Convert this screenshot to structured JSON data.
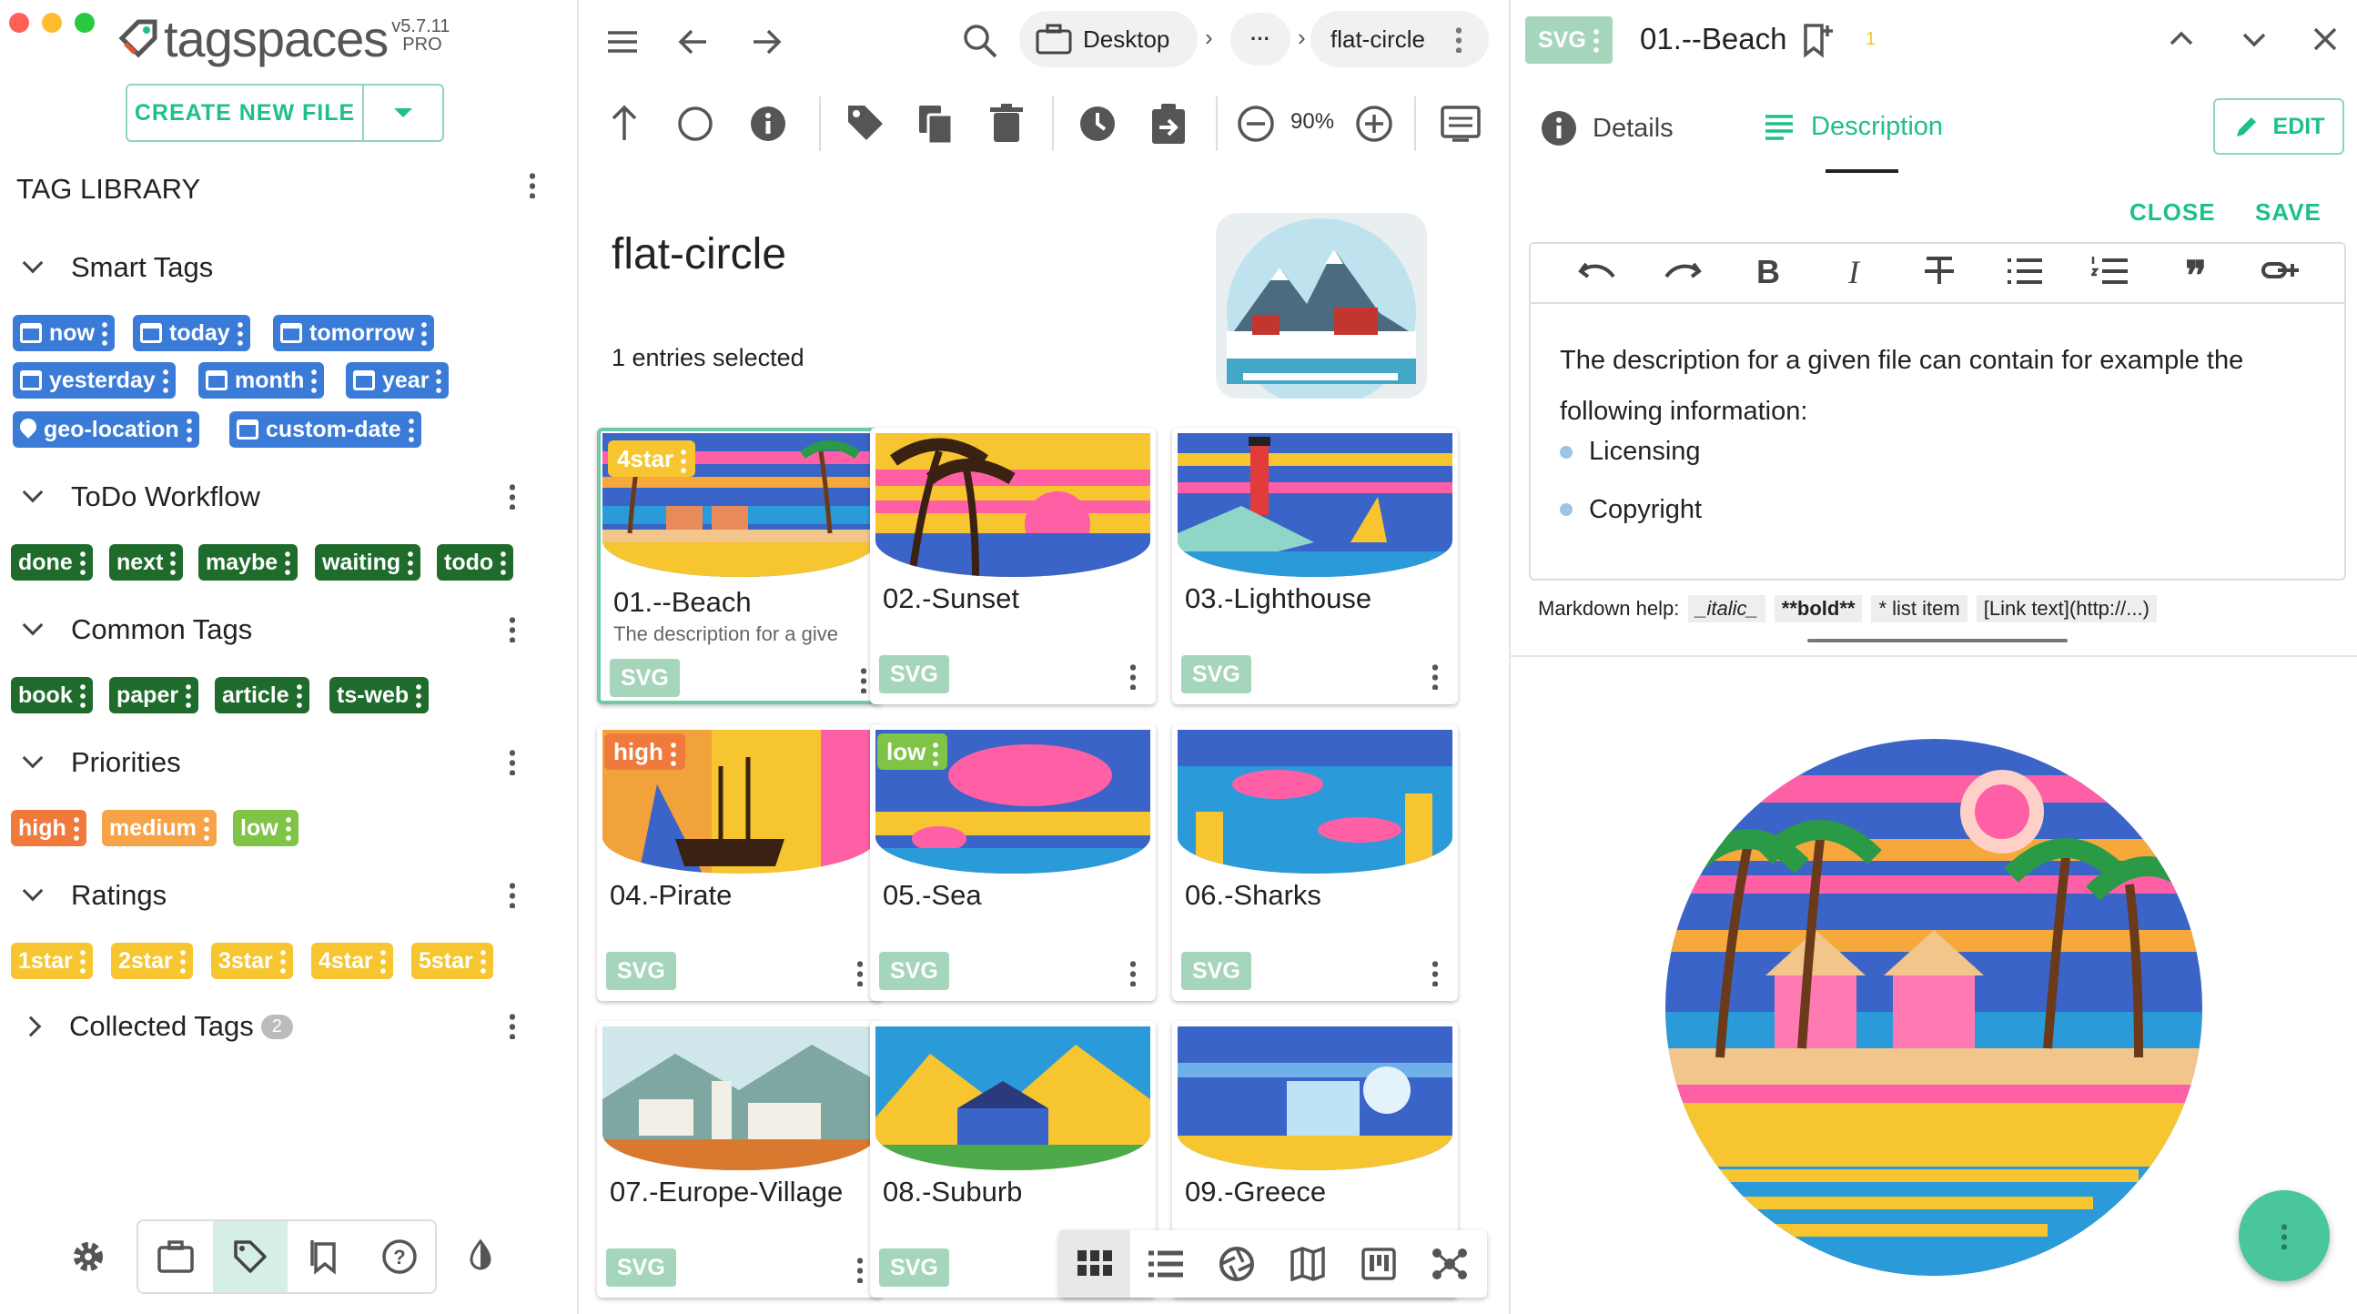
{
  "app": {
    "brand": "tagspaces",
    "version": "v5.7.11",
    "edition": "PRO",
    "create_button": "CREATE NEW FILE"
  },
  "sidebar": {
    "title": "TAG LIBRARY",
    "groups": [
      {
        "name": "Smart Tags",
        "tags": [
          "now",
          "today",
          "tomorrow",
          "yesterday",
          "month",
          "year",
          "geo-location",
          "custom-date"
        ]
      },
      {
        "name": "ToDo Workflow",
        "tags": [
          "done",
          "next",
          "maybe",
          "waiting",
          "todo"
        ]
      },
      {
        "name": "Common Tags",
        "tags": [
          "book",
          "paper",
          "article",
          "ts-web"
        ]
      },
      {
        "name": "Priorities",
        "tags": [
          "high",
          "medium",
          "low"
        ]
      },
      {
        "name": "Ratings",
        "tags": [
          "1star",
          "2star",
          "3star",
          "4star",
          "5star"
        ]
      },
      {
        "name": "Collected Tags",
        "count": "2"
      }
    ]
  },
  "colors": {
    "smart": "#3b7bd8",
    "todo": "#1e6b2c",
    "high": "#f07a3c",
    "medium": "#f6a447",
    "low": "#7fc447",
    "rating": "#f6c530",
    "ext": "#a5d5ba",
    "accent": "#1dbf8a"
  },
  "toolbar": {
    "location": "Desktop",
    "ellipsis": "···",
    "folder": "flat-circle",
    "zoom": "90%"
  },
  "folder": {
    "title": "flat-circle",
    "selection": "1 entries selected"
  },
  "files": [
    {
      "name": "01.--Beach",
      "desc": "The description for a give",
      "ext": "SVG",
      "tag": "4star"
    },
    {
      "name": "02.-Sunset",
      "ext": "SVG"
    },
    {
      "name": "03.-Lighthouse",
      "ext": "SVG"
    },
    {
      "name": "04.-Pirate",
      "ext": "SVG",
      "tag": "high"
    },
    {
      "name": "05.-Sea",
      "ext": "SVG",
      "tag": "low"
    },
    {
      "name": "06.-Sharks",
      "ext": "SVG"
    },
    {
      "name": "07.-Europe-Village",
      "ext": "SVG"
    },
    {
      "name": "08.-Suburb",
      "ext": "SVG"
    },
    {
      "name": "09.-Greece",
      "ext": "SVG"
    }
  ],
  "preview": {
    "ext": "SVG",
    "title": "01.--Beach",
    "badge": "1",
    "tabs": {
      "details": "Details",
      "description": "Description"
    },
    "edit": "EDIT",
    "close": "CLOSE",
    "save": "SAVE",
    "text": "The description for a given file can contain for example the following information:",
    "bullets": [
      "Licensing",
      "Copyright"
    ],
    "md_label": "Markdown help:",
    "md_hints": [
      "_italic_",
      "**bold**",
      "* list item",
      "[Link text](http://...)"
    ]
  }
}
